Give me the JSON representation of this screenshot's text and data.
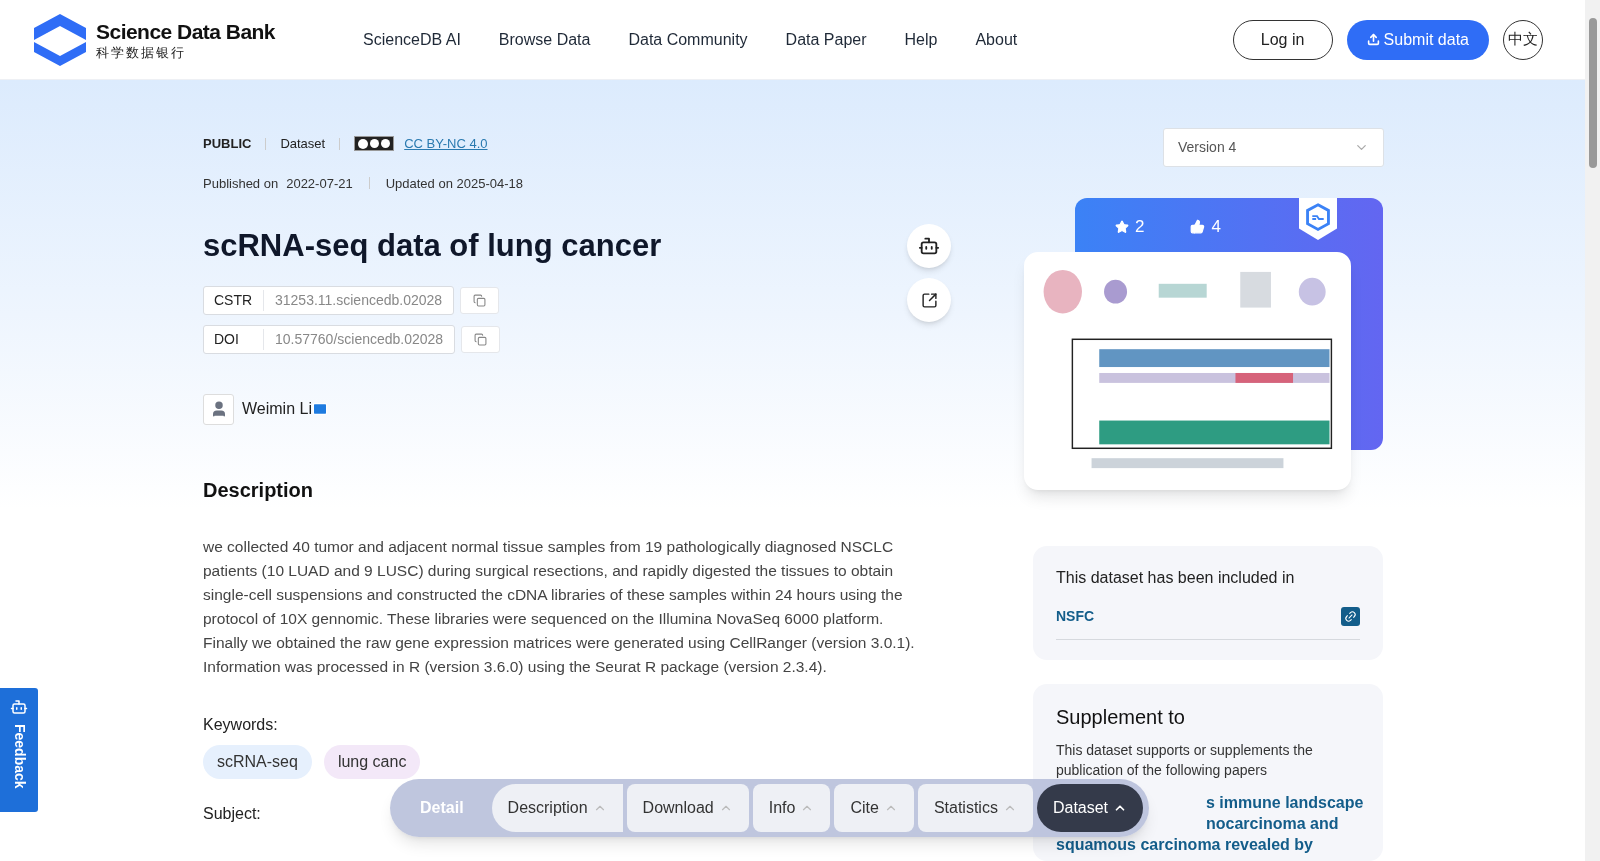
{
  "header": {
    "logo_title": "Science Data Bank",
    "logo_subtitle": "科学数据银行",
    "nav": [
      "ScienceDB AI",
      "Browse Data",
      "Data Community",
      "Data Paper",
      "Help",
      "About"
    ],
    "login": "Log in",
    "submit": "Submit data",
    "language": "中文"
  },
  "meta": {
    "access": "PUBLIC",
    "type": "Dataset",
    "license": "CC BY-NC 4.0",
    "published_label": "Published on",
    "published": "2022-07-21",
    "updated": "Updated on 2025-04-18"
  },
  "title": "scRNA-seq data of lung cancer",
  "identifiers": [
    {
      "label": "CSTR",
      "value": "31253.11.sciencedb.02028"
    },
    {
      "label": "DOI",
      "value": "10.57760/sciencedb.02028"
    }
  ],
  "author": {
    "name": "Weimin Li"
  },
  "description": {
    "heading": "Description",
    "text": "we collected 40 tumor and adjacent normal tissue samples from 19 pathologically diagnosed NSCLC patients (10 LUAD and 9 LUSC) during surgical resections, and rapidly digested the tissues to obtain single-cell suspensions and constructed the cDNA libraries of these samples within 24 hours using the protocol of 10X gennomic. These libraries were sequenced on the Illumina NovaSeq 6000 platform. Finally we obtained the raw gene expression matrices were generated using CellRanger (version 3.0.1). Information was processed in R (version 3.6.0) using the Seurat R package (version 2.3.4)."
  },
  "keywords": {
    "label": "Keywords:",
    "items": [
      {
        "label": "scRNA-seq",
        "color": "#e6f0fd"
      },
      {
        "label": "lung canc",
        "color": "#f3e8f8"
      }
    ]
  },
  "subject_label": "Subject:",
  "sidebar": {
    "version": "Version 4",
    "stars": "2",
    "likes": "4",
    "included": {
      "heading": "This dataset has been included in",
      "items": [
        "NSFC"
      ]
    },
    "supplement": {
      "heading": "Supplement to",
      "text": "This dataset supports or supplements the publication of the following papers",
      "paper_lines": [
        "s immune landscape",
        "nocarcinoma and",
        "squamous carcinoma revealed by"
      ]
    }
  },
  "bottom_nav": {
    "label": "Detail",
    "tabs": [
      {
        "label": "Description",
        "selected": false
      },
      {
        "label": "Download",
        "selected": false
      },
      {
        "label": "Info",
        "selected": false
      },
      {
        "label": "Cite",
        "selected": false
      },
      {
        "label": "Statistics",
        "selected": false
      },
      {
        "label": "Dataset",
        "selected": true
      }
    ]
  },
  "feedback": "Feedback"
}
